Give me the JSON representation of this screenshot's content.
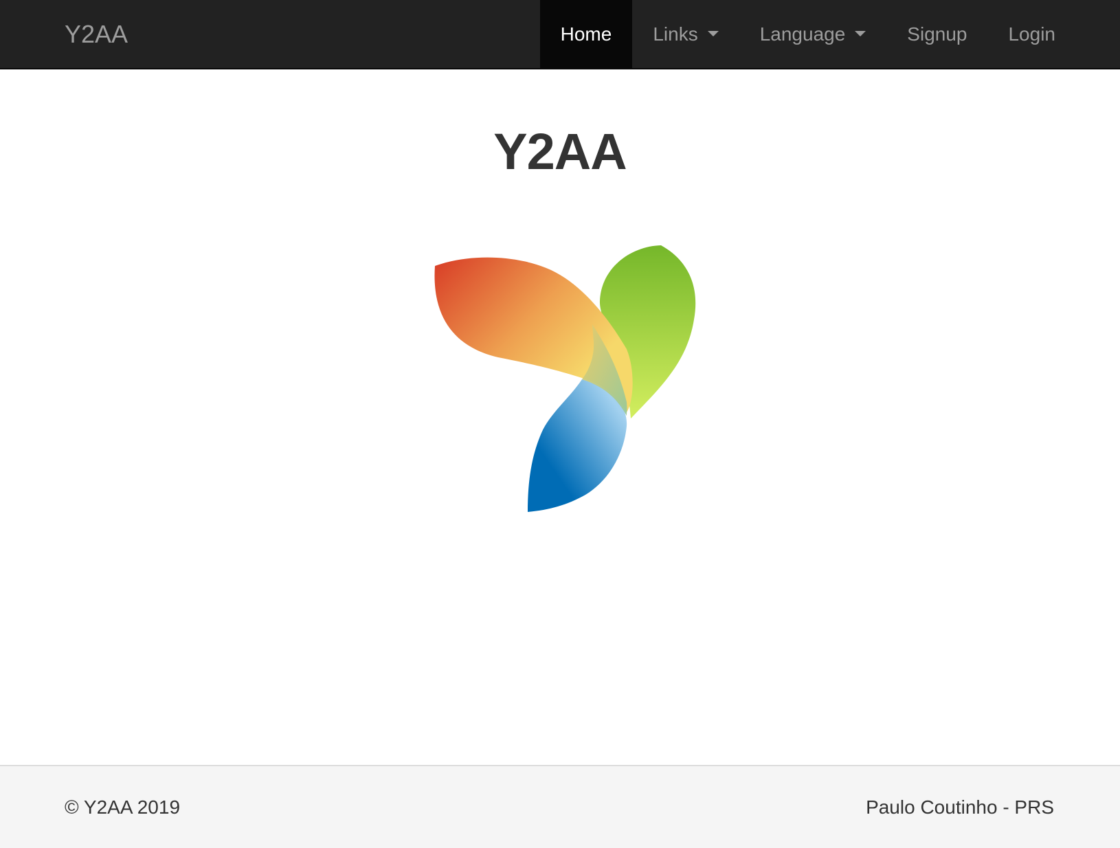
{
  "navbar": {
    "brand": "Y2AA",
    "items": [
      {
        "label": "Home",
        "active": true
      },
      {
        "label": "Links",
        "dropdown": true
      },
      {
        "label": "Language",
        "dropdown": true
      },
      {
        "label": "Signup"
      },
      {
        "label": "Login"
      }
    ]
  },
  "main": {
    "title": "Y2AA",
    "logo_icon": "yii-framework-logo-icon",
    "logo_colors": {
      "red": "#d9402a",
      "orange": "#eea050",
      "yellow": "#f6d86a",
      "green_dark": "#75b72a",
      "green_light": "#d0ec5c",
      "blue_dark": "#006cb5",
      "blue_light": "#a0cfee"
    }
  },
  "footer": {
    "left": "© Y2AA 2019",
    "right": "Paulo Coutinho - PRS"
  },
  "colors": {
    "navbar_bg": "#222222",
    "navbar_text": "#9d9d9d",
    "navbar_active_bg": "#080808",
    "navbar_active_text": "#ffffff",
    "footer_bg": "#f5f5f5",
    "text": "#333333"
  }
}
